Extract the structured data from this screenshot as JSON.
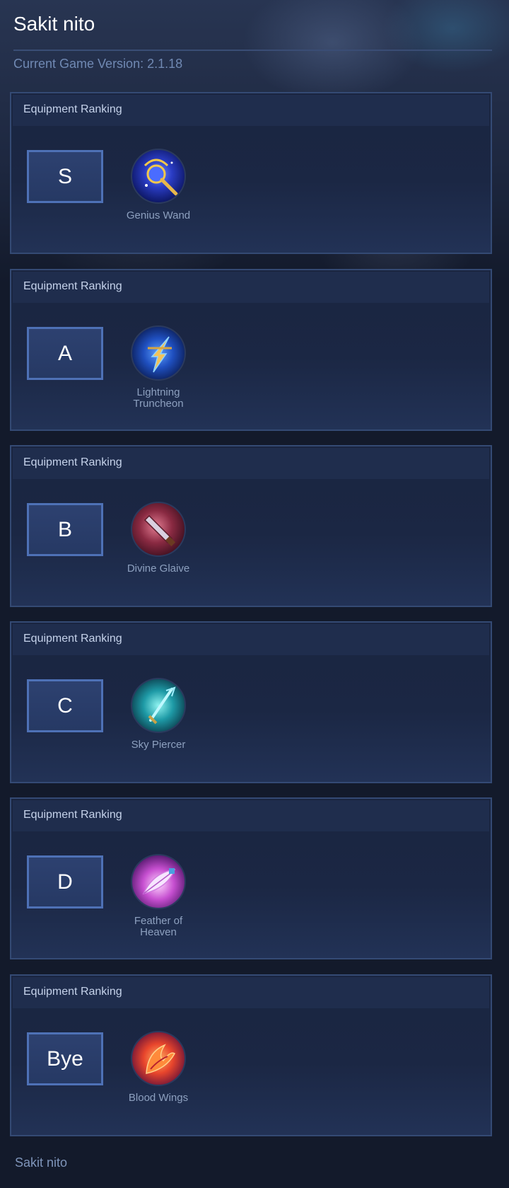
{
  "site": {
    "title": "Sakit nito",
    "version_text": "Current Game Version: 2.1.18",
    "footer": "Sakit nito"
  },
  "rankings": [
    {
      "header": "Equipment Ranking",
      "tier": "S",
      "item": {
        "name": "Genius Wand",
        "icon": "genius-wand-icon"
      }
    },
    {
      "header": "Equipment Ranking",
      "tier": "A",
      "item": {
        "name": "Lightning Truncheon",
        "icon": "lightning-truncheon-icon"
      }
    },
    {
      "header": "Equipment Ranking",
      "tier": "B",
      "item": {
        "name": "Divine Glaive",
        "icon": "divine-glaive-icon"
      }
    },
    {
      "header": "Equipment Ranking",
      "tier": "C",
      "item": {
        "name": "Sky Piercer",
        "icon": "sky-piercer-icon"
      }
    },
    {
      "header": "Equipment Ranking",
      "tier": "D",
      "item": {
        "name": "Feather of Heaven",
        "icon": "feather-of-heaven-icon"
      }
    },
    {
      "header": "Equipment Ranking",
      "tier": "Bye",
      "item": {
        "name": "Blood Wings",
        "icon": "blood-wings-icon"
      }
    }
  ],
  "colors": {
    "background": "#131a2b",
    "card_border": "#344a74",
    "tier_border": "#4e71b6",
    "muted_text": "#8da0bf"
  }
}
